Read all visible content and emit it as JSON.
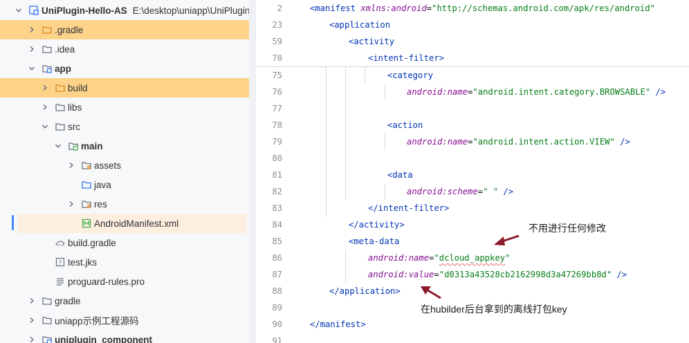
{
  "project_tree": {
    "root": {
      "name": "UniPlugin-Hello-AS",
      "path": "E:\\desktop\\uniapp\\UniPlugin-He"
    },
    "items": [
      {
        "label": ".gradle"
      },
      {
        "label": ".idea"
      },
      {
        "label": "app"
      },
      {
        "label": "build"
      },
      {
        "label": "libs"
      },
      {
        "label": "src"
      },
      {
        "label": "main"
      },
      {
        "label": "assets"
      },
      {
        "label": "java"
      },
      {
        "label": "res"
      },
      {
        "label": "AndroidManifest.xml"
      },
      {
        "label": "build.gradle"
      },
      {
        "label": "test.jks"
      },
      {
        "label": "proguard-rules.pro"
      },
      {
        "label": "gradle"
      },
      {
        "label": "uniapp示例工程源码"
      },
      {
        "label": "uniplugin_component"
      }
    ]
  },
  "editor": {
    "sticky_lines": [
      {
        "num": "2",
        "open": "<manifest",
        "ns": "xmlns:android",
        "eq": "=",
        "value": "\"http://schemas.android.com/apk/res/android\""
      },
      {
        "num": "23",
        "open": "<application"
      },
      {
        "num": "59",
        "open": "<activity"
      },
      {
        "num": "70",
        "open": "<intent-filter",
        "close": ">"
      }
    ],
    "lines": [
      {
        "num": "75",
        "tag": "<category"
      },
      {
        "num": "76",
        "attr": "android:name",
        "eq": "=",
        "value": "\"android.intent.category.BROWSABLE\"",
        "end": " />"
      },
      {
        "num": "77"
      },
      {
        "num": "78",
        "tag": "<action"
      },
      {
        "num": "79",
        "attr": "android:name",
        "eq": "=",
        "value": "\"android.intent.action.VIEW\"",
        "end": " />"
      },
      {
        "num": "80"
      },
      {
        "num": "81",
        "tag": "<data"
      },
      {
        "num": "82",
        "attr": "android:scheme",
        "eq": "=",
        "value": "\" \"",
        "end": " />"
      },
      {
        "num": "83",
        "tag": "</intent-filter>"
      },
      {
        "num": "84",
        "tag": "</activity>"
      },
      {
        "num": "85",
        "tag": "<meta-data"
      },
      {
        "num": "86",
        "attr": "android:name",
        "eq": "=",
        "value_q1": "\"",
        "value_inner": "dcloud_appkey",
        "value_q2": "\""
      },
      {
        "num": "87",
        "attr": "android:value",
        "eq": "=",
        "value": "\"d0313a43528cb2162998d3a47269bb8d\"",
        "end": " />"
      },
      {
        "num": "88",
        "tag": "</application>"
      },
      {
        "num": "89"
      },
      {
        "num": "90",
        "tag": "</manifest>"
      },
      {
        "num": "91"
      }
    ]
  },
  "annotations": {
    "note1": "不用进行任何修改",
    "note2": "在hubilder后台拿到的离线打包key"
  },
  "colors": {
    "highlight_row": "#fdd38a",
    "selected_row": "#fcefdf",
    "arrow": "#8b1a2b"
  }
}
